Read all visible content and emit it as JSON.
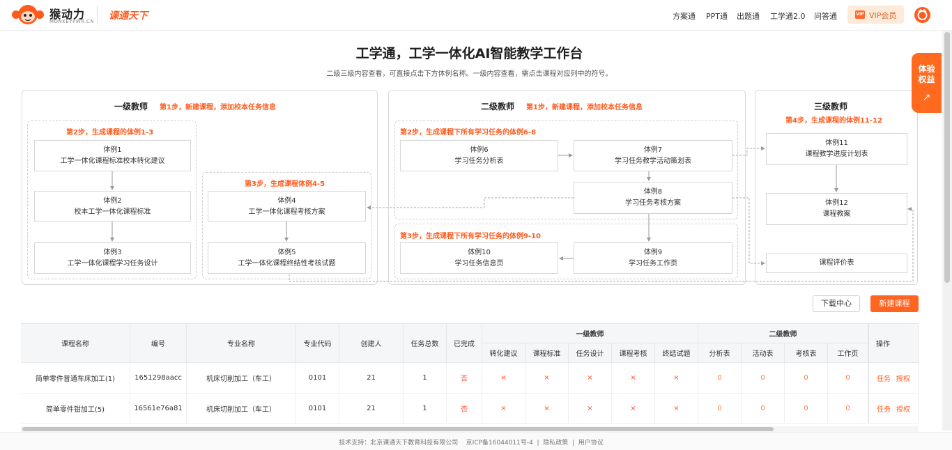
{
  "header": {
    "logo_title": "猴动力",
    "logo_sub": "MONKEYPWR.CN",
    "brand": "课通天下",
    "nav": [
      "方案通",
      "PPT通",
      "出题通",
      "工学通2.0",
      "问答通"
    ],
    "vip_tag": "VIP",
    "vip_label": "VIP会员",
    "accent_color": "#ff5b1f"
  },
  "hero": {
    "title": "工学通，工学一体化AI智能教学工作台",
    "subtitle": "二级三级内容查看，可直接点击下方体例名称。一级内容查看，需点击课程对应列中的符号。"
  },
  "side_tag": {
    "label_1": "体验",
    "label_2": "权益",
    "arrow": "↗"
  },
  "diagram": {
    "level1": {
      "title": "一级教师",
      "step1": "第1步，新建课程，添加校本任务信息",
      "step2": "第2步，生成课程的体例1-3",
      "step3": "第3步，生成课程体例4-5",
      "n1": [
        "体例1",
        "工学一体化课程标准校本转化建议"
      ],
      "n2": [
        "体例2",
        "校本工学一体化课程标准"
      ],
      "n3": [
        "体例3",
        "工学一体化课程学习任务设计"
      ],
      "n4": [
        "体例4",
        "工学一体化课程考核方案"
      ],
      "n5": [
        "体例5",
        "工学一体化课程终结性考核试题"
      ]
    },
    "level2": {
      "title": "二级教师",
      "step1": "第1步，新建课程，添加校本任务信息",
      "step2": "第2步，生成课程下所有学习任务的体例6-8",
      "step3": "第3步，生成课程下所有学习任务的体例9-10",
      "n6": [
        "体例6",
        "学习任务分析表"
      ],
      "n7": [
        "体例7",
        "学习任务教学活动策划表"
      ],
      "n8": [
        "体例8",
        "学习任务考核方案"
      ],
      "n9": [
        "体例9",
        "学习任务工作页"
      ],
      "n10": [
        "体例10",
        "学习任务信息页"
      ]
    },
    "level3": {
      "title": "三级教师",
      "step4": "第4步，生成课程的体例11-12",
      "n11": [
        "体例11",
        "课程教学进度计划表"
      ],
      "n12": [
        "体例12",
        "课程教案"
      ],
      "n13": "课程评价表"
    }
  },
  "actions": {
    "download": "下载中心",
    "new_course": "新建课程"
  },
  "table": {
    "headers": {
      "course_name": "课程名称",
      "code": "编号",
      "major": "专业名称",
      "major_code": "专业代码",
      "creator": "创建人",
      "task_total": "任务总数",
      "done": "已完成",
      "group1": "一级教师",
      "group2": "二级教师",
      "ops": "操作",
      "g1_cols": [
        "转化建议",
        "课程标准",
        "任务设计",
        "课程考核",
        "终结试题"
      ],
      "g2_cols": [
        "分析表",
        "活动表",
        "考核表",
        "工作页"
      ]
    },
    "rows": [
      {
        "course_name": "简单零件普通车床加工(1)",
        "code": "1651298aacc",
        "major": "机床切削加工（车工）",
        "major_code": "0101",
        "creator": "21",
        "task_total": "1",
        "done": "否",
        "g1": [
          "×",
          "×",
          "×",
          "×",
          "×"
        ],
        "g2": [
          "0",
          "0",
          "0",
          "0"
        ],
        "op_task": "任务",
        "op_auth": "授权"
      },
      {
        "course_name": "简单零件钳加工(5)",
        "code": "16561e76a81",
        "major": "机床切削加工（车工）",
        "major_code": "0101",
        "creator": "21",
        "task_total": "1",
        "done": "否",
        "g1": [
          "×",
          "×",
          "×",
          "×",
          "×"
        ],
        "g2": [
          "0",
          "0",
          "0",
          "0"
        ],
        "op_task": "任务",
        "op_auth": "授权"
      }
    ]
  },
  "footer": {
    "text": "技术支持：北京课通天下教育科技有限公司    京ICP备16044011号-4  |  隐私政策  |  用户协议"
  }
}
